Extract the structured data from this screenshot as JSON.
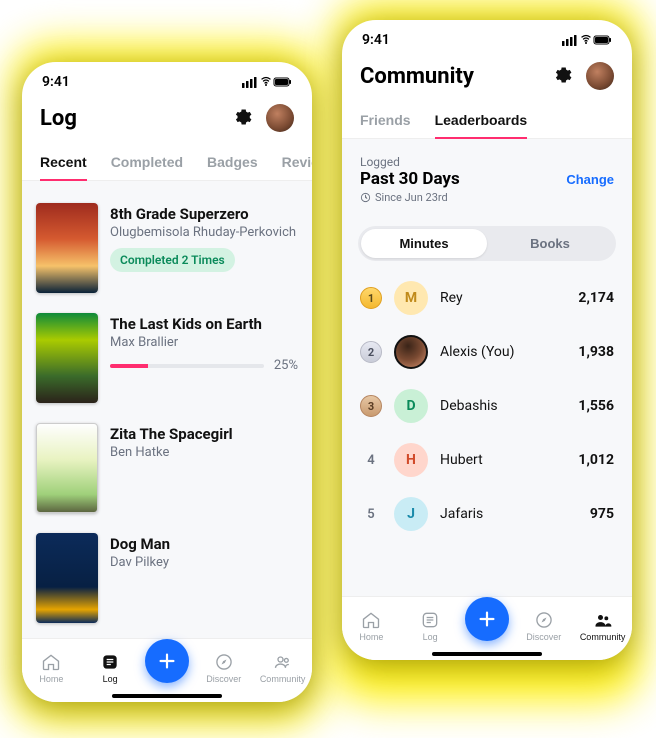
{
  "status": {
    "time": "9:41"
  },
  "log": {
    "title": "Log",
    "tabs": [
      "Recent",
      "Completed",
      "Badges",
      "Reviews"
    ],
    "active_tab": 0,
    "items": [
      {
        "title": "8th Grade Superzero",
        "author": "Olugbemisola Rhuday-Perkovich",
        "badge": "Completed 2 Times"
      },
      {
        "title": "The Last Kids on Earth",
        "author": "Max Brallier",
        "progress_pct": "25%"
      },
      {
        "title": "Zita The Spacegirl",
        "author": "Ben Hatke"
      },
      {
        "title": "Dog Man",
        "author": "Dav Pilkey"
      }
    ]
  },
  "community": {
    "title": "Community",
    "tabs": [
      "Friends",
      "Leaderboards"
    ],
    "active_tab": 1,
    "logged_label": "Logged",
    "period_title": "Past 30 Days",
    "change_label": "Change",
    "since_label": "Since Jun 23rd",
    "segments": [
      "Minutes",
      "Books"
    ],
    "active_segment": 0,
    "leaderboard": [
      {
        "rank": "1",
        "initial": "M",
        "name": "Rey",
        "value": "2,174"
      },
      {
        "rank": "2",
        "initial": "",
        "name": "Alexis (You)",
        "value": "1,938"
      },
      {
        "rank": "3",
        "initial": "D",
        "name": "Debashis",
        "value": "1,556"
      },
      {
        "rank": "4",
        "initial": "H",
        "name": "Hubert",
        "value": "1,012"
      },
      {
        "rank": "5",
        "initial": "J",
        "name": "Jafaris",
        "value": "975"
      }
    ]
  },
  "nav": {
    "items": [
      "Home",
      "Log",
      "Discover",
      "Community"
    ]
  }
}
